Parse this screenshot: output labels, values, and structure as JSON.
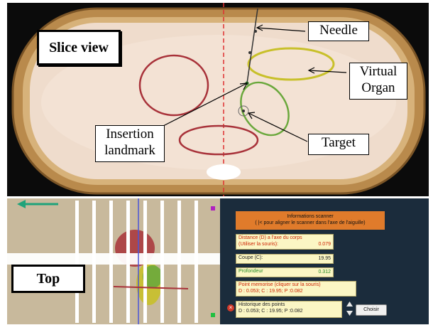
{
  "slice_view": {
    "title": "Slice view",
    "callouts": {
      "needle": "Needle",
      "organ_line1": "Virtual",
      "organ_line2": "Organ",
      "insertion_line1": "Insertion",
      "insertion_line2": "landmark",
      "target": "Target"
    }
  },
  "top_view": {
    "title": "Top"
  },
  "info_panel": {
    "header_line1": "Informations scanner",
    "header_line2": "( |< pour aligner le scanner dans l'axe de l'aiguille)",
    "distance_label_line1": "Distance  (D) a l'axe du corps",
    "distance_label_line2": "(Utiliser la souris):",
    "distance_value": "0.079",
    "coupe_label": "Coupe (C):",
    "coupe_value": "19.95",
    "profondeur_label": "Profondeur",
    "profondeur_value": "0.312",
    "memorise_label": "Point memorise (cliquer sur la souris)",
    "memorise_value": "D : 0.053; C : 19.95; P :0.082",
    "historique_label": "Historique des points",
    "historique_value": "D : 0.053; C : 19.95; P :0.082",
    "choose_label": "Choisir",
    "close_icon": "×"
  },
  "colors": {
    "wood": "#c89a55",
    "skin": "#efd9c9",
    "organ_red": "#a8323a",
    "organ_yellow": "#c8c02a",
    "organ_green": "#6aa83c",
    "axis_red": "#e03030",
    "lower_bg": "#1b2c3c",
    "header_orange": "#e07b2b"
  }
}
